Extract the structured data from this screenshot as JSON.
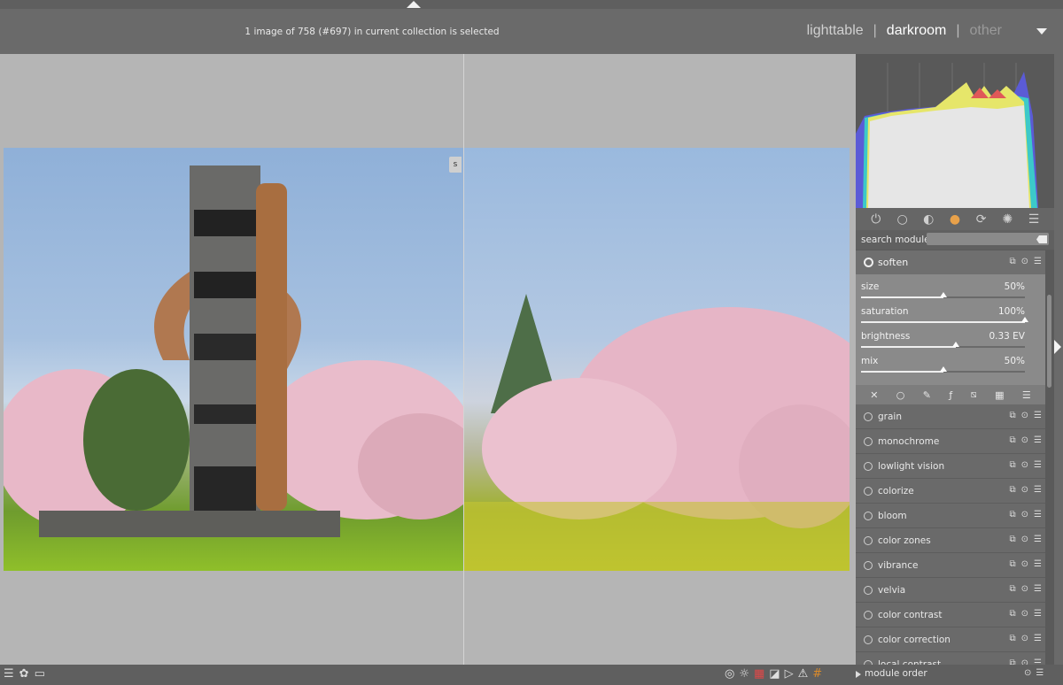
{
  "header": {
    "collection_info": "1 image of 758 (#697) in current collection is selected",
    "views": [
      "lighttable",
      "darkroom",
      "other"
    ],
    "active_view": "darkroom"
  },
  "canvas": {
    "split_marker": "s"
  },
  "right_panel": {
    "module_groups": [
      "power-icon",
      "circle-icon",
      "tone-icon",
      "color-icon",
      "correct-icon",
      "effect-icon",
      "menu-icon"
    ],
    "search_label": "search module",
    "search_value": "",
    "expanded_module": {
      "name": "soften",
      "sliders": [
        {
          "label": "size",
          "value": "50%",
          "fraction": 0.5
        },
        {
          "label": "saturation",
          "value": "100%",
          "fraction": 1.0
        },
        {
          "label": "brightness",
          "value": "0.33 EV",
          "fraction": 0.58
        },
        {
          "label": "mix",
          "value": "50%",
          "fraction": 0.5
        }
      ]
    },
    "modules": [
      "grain",
      "monochrome",
      "lowlight vision",
      "colorize",
      "bloom",
      "color zones",
      "vibrance",
      "velvia",
      "color contrast",
      "color correction",
      "local contrast"
    ]
  },
  "bottom_bar": {
    "module_order": "module order"
  },
  "colors": {
    "accent_active": "#ffffff",
    "panel": "#5a5a5a"
  }
}
